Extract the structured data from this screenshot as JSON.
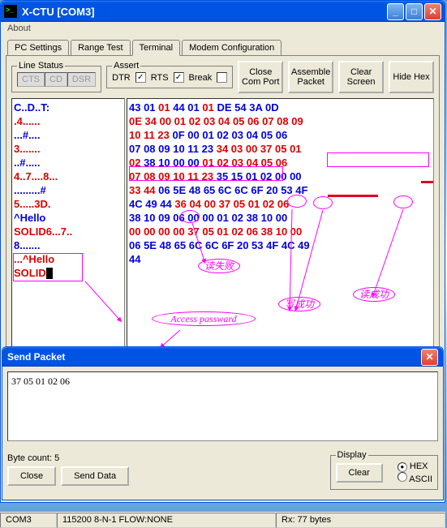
{
  "window": {
    "title": "X-CTU   [COM3]",
    "menu": {
      "about": "About"
    },
    "tabs": [
      "PC Settings",
      "Range Test",
      "Terminal",
      "Modem Configuration"
    ],
    "activeTab": 2,
    "lineStatus": {
      "legend": "Line Status",
      "cts": "CTS",
      "cd": "CD",
      "dsr": "DSR"
    },
    "assert": {
      "legend": "Assert",
      "dtr": "DTR",
      "dtrChecked": "✓",
      "rts": "RTS",
      "rtsChecked": "✓",
      "break": "Break",
      "breakChecked": ""
    },
    "buttons": {
      "close": "Close\nCom Port",
      "assemble": "Assemble\nPacket",
      "clear": "Clear\nScreen",
      "hide": "Hide\nHex"
    },
    "statusbar": {
      "port": "COM3",
      "cfg": "115200 8-N-1  FLOW:NONE",
      "rx": "Rx: 77 bytes"
    }
  },
  "terminal": {
    "leftLines": [
      {
        "t": "C..D..T:",
        "c": "blue"
      },
      {
        "t": ".4......",
        "c": "red"
      },
      {
        "t": "...#....",
        "c": "blue"
      },
      {
        "t": "3.......",
        "c": "red"
      },
      {
        "t": "..#.....",
        "c": "blue"
      },
      {
        "t": "4..7....8...",
        "c": "red"
      },
      {
        "t": ".........#",
        "c": "blue"
      },
      {
        "t": "5.....3D.",
        "c": "red"
      },
      {
        "t": "^Hello",
        "c": "blue"
      },
      {
        "t": "SOLID6...7..",
        "c": "red"
      },
      {
        "t": "8.......",
        "c": "blue"
      },
      {
        "t": "...^Hello",
        "c": "red"
      },
      {
        "t": "SOLID",
        "c": "red"
      }
    ],
    "rightLines": [
      [
        {
          "t": "43 01",
          "c": "blue"
        },
        {
          "t": " 01 ",
          "c": "red"
        },
        {
          "t": "44 01 ",
          "c": "blue"
        },
        {
          "t": "01 ",
          "c": "red"
        },
        {
          "t": "DE 54 3A 0D",
          "c": "blue"
        }
      ],
      [
        {
          "t": "0E 34 00 01 02 03 04 05 06 07 08 09",
          "c": "red"
        }
      ],
      [
        {
          "t": "10 11 23 ",
          "c": "red"
        },
        {
          "t": "0F 00 01 02 03 04 05 06",
          "c": "blue"
        }
      ],
      [
        {
          "t": "07 08 09 10 11 23 ",
          "c": "blue"
        },
        {
          "t": "34 03 00 37 05 01",
          "c": "red"
        }
      ],
      [
        {
          "t": "02 ",
          "c": "red"
        },
        {
          "t": "38 10 00 00 ",
          "c": "blue"
        },
        {
          "t": "01 02 03 04 05 06",
          "c": "red"
        }
      ],
      [
        {
          "t": "07 08 09 10 11 23 ",
          "c": "red"
        },
        {
          "t": "35 15 01 02 00 00",
          "c": "blue"
        }
      ],
      [
        {
          "t": "33 44 ",
          "c": "red"
        },
        {
          "t": "06 5E 48 65 6C 6C 6F 20 53 4F",
          "c": "blue"
        }
      ],
      [
        {
          "t": "4C 49 44 ",
          "c": "blue"
        },
        {
          "t": "36 04 00 37 05 01 02 06",
          "c": "red"
        }
      ],
      [
        {
          "t": "38 10 09 06 00 00 01 02 38 10 00",
          "c": "blue"
        }
      ],
      [
        {
          "t": "00 00 00 00 37 05 01 02 06 38 10 00",
          "c": "red"
        }
      ],
      [
        {
          "t": "06 5E 48 65 6C 6C 6F 20 53 4F 4C 49",
          "c": "blue"
        }
      ],
      [
        {
          "t": "44",
          "c": "blue"
        }
      ]
    ],
    "annotations": {
      "readFail": "读失败",
      "accessPwd": "Access passward",
      "writeOk": "写成功",
      "readOk": "读成功"
    }
  },
  "sendPacket": {
    "title": "Send Packet",
    "text": "37 05 01 02 06",
    "byteCount": "Byte count:  5",
    "close": "Close",
    "send": "Send Data",
    "clear": "Clear",
    "display": {
      "legend": "Display",
      "hex": "HEX",
      "ascii": "ASCII",
      "selected": "hex"
    }
  }
}
